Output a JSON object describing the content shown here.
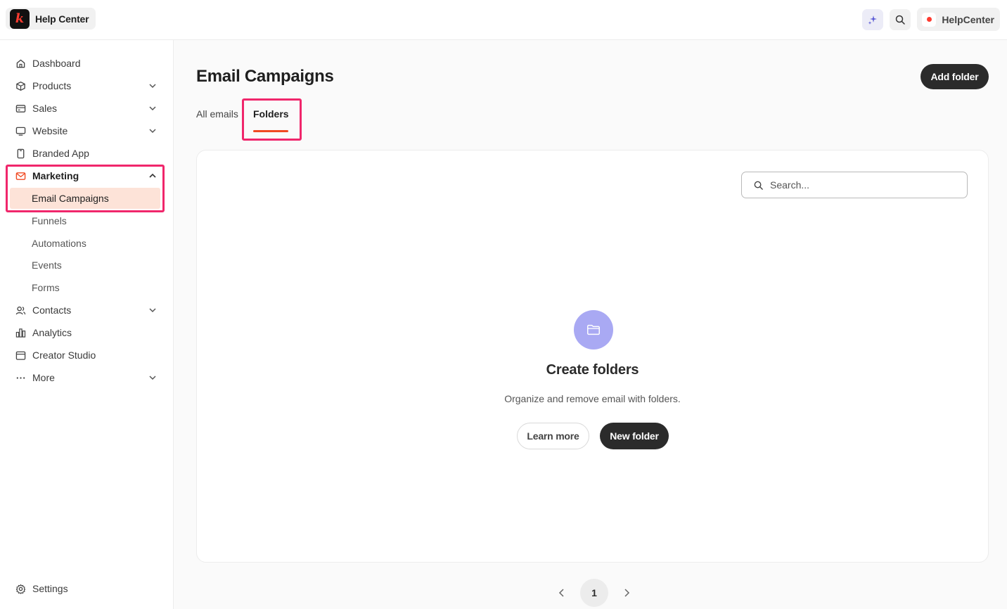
{
  "brand": {
    "name": "Help Center"
  },
  "header": {
    "account_name": "HelpCenter"
  },
  "sidebar": {
    "items": [
      {
        "label": "Dashboard"
      },
      {
        "label": "Products"
      },
      {
        "label": "Sales"
      },
      {
        "label": "Website"
      },
      {
        "label": "Branded App"
      },
      {
        "label": "Marketing"
      },
      {
        "label": "Contacts"
      },
      {
        "label": "Analytics"
      },
      {
        "label": "Creator Studio"
      },
      {
        "label": "More"
      }
    ],
    "marketing_sub": [
      {
        "label": "Email Campaigns"
      },
      {
        "label": "Funnels"
      },
      {
        "label": "Automations"
      },
      {
        "label": "Events"
      },
      {
        "label": "Forms"
      }
    ],
    "settings_label": "Settings"
  },
  "main": {
    "title": "Email Campaigns",
    "add_folder_label": "Add folder",
    "tabs": [
      {
        "label": "All emails"
      },
      {
        "label": "Folders"
      }
    ],
    "search_placeholder": "Search...",
    "empty_state": {
      "title": "Create folders",
      "text": "Organize and remove email with folders.",
      "learn_more_label": "Learn more",
      "new_folder_label": "New folder"
    },
    "pagination": {
      "current_page": "1"
    }
  },
  "colors": {
    "accent": "#f04a23",
    "highlight": "#f0266b",
    "active_bg": "#fde3d8",
    "empty_icon_bg": "#a9a9f3",
    "primary_button": "#2b2b2b"
  },
  "icons": {
    "brand": "brand-logo-icon",
    "ai": "sparkles-icon",
    "search": "search-icon",
    "folder": "folder-icon"
  }
}
